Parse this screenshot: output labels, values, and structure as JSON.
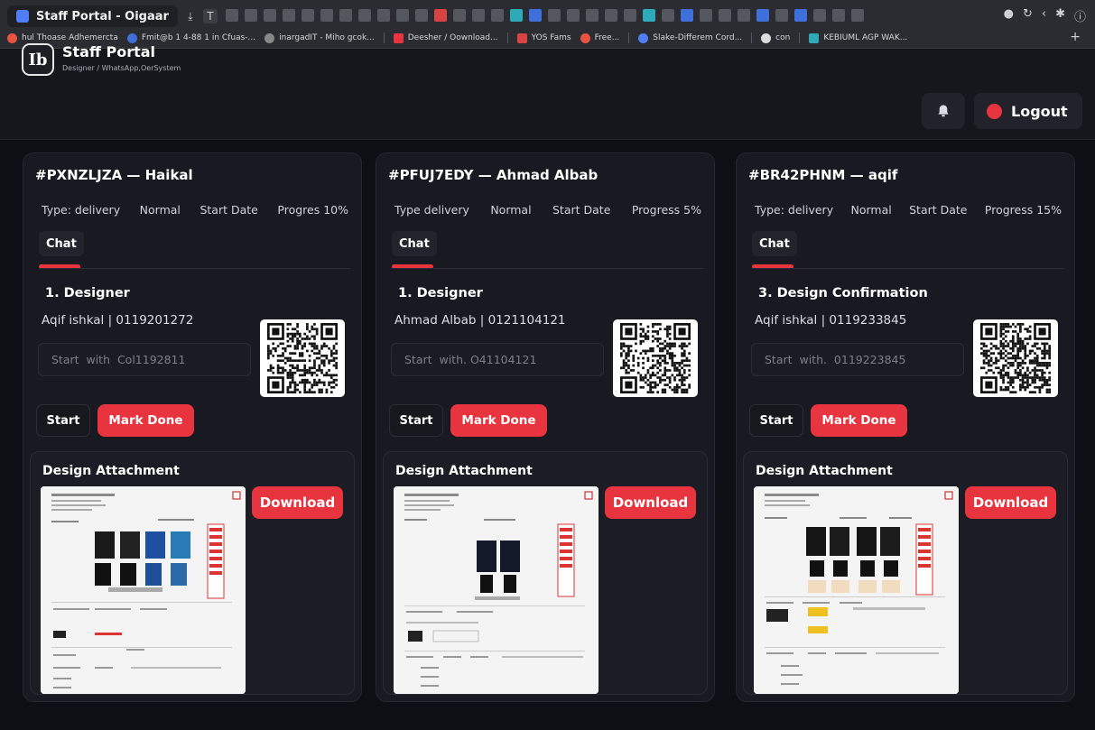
{
  "browser": {
    "active_tab": "Staff Portal - Oigaar",
    "bookmarks": [
      "hul Thoase Adhemercta",
      "Fmit@b 1 4-88 1 in Cfuas-...",
      "inargadIT - Miho gcok...",
      "Deesher / Oownload...",
      "YOS Fams",
      "Free...",
      "Slake-Differem Cord...",
      "con",
      "KEBIUML AGP WAK...",
      "+"
    ]
  },
  "header": {
    "logo_text": "Ib",
    "title": "Staff Portal",
    "subtitle": "Designer / WhatsApp,OerSystem",
    "logout_label": "Logout"
  },
  "cards": [
    {
      "title": "#PXNZLJZA — Haikal",
      "type": "Type: delivery",
      "priority": "Normal",
      "start": "Start Date",
      "progress": "Progres 10%",
      "chat_tab": "Chat",
      "stage": "1. Designer",
      "contact": "Aqif ishkal | 0119201272",
      "placeholder": "Start  with  Col1192811",
      "start_label": "Start",
      "done_label": "Mark Done",
      "attach_title": "Design Attachment",
      "download_label": "Download"
    },
    {
      "title": "#PFUJ7EDY — Ahmad Albab",
      "type": "Type delivery",
      "priority": "Normal",
      "start": "Start Date",
      "progress": "Progress 5%",
      "chat_tab": "Chat",
      "stage": "1. Designer",
      "contact": "Ahmad Albab | 0121104121",
      "placeholder": "Start  with. O41104121",
      "start_label": "Start",
      "done_label": "Mark Done",
      "attach_title": "Design Attachment",
      "download_label": "Download"
    },
    {
      "title": "#BR42PHNM — aqif",
      "type": "Type: delivery",
      "priority": "Normal",
      "start": "Start Date",
      "progress": "Progress 15%",
      "chat_tab": "Chat",
      "stage": "3. Design Confirmation",
      "contact": "Aqif ishkal | 0119233845",
      "placeholder": "Start  with.  0119223845",
      "start_label": "Start",
      "done_label": "Mark Done",
      "attach_title": "Design Attachment",
      "download_label": "Download"
    }
  ],
  "colors": {
    "accent": "#e8343f",
    "background": "#0e0f14",
    "card": "#191a21"
  }
}
